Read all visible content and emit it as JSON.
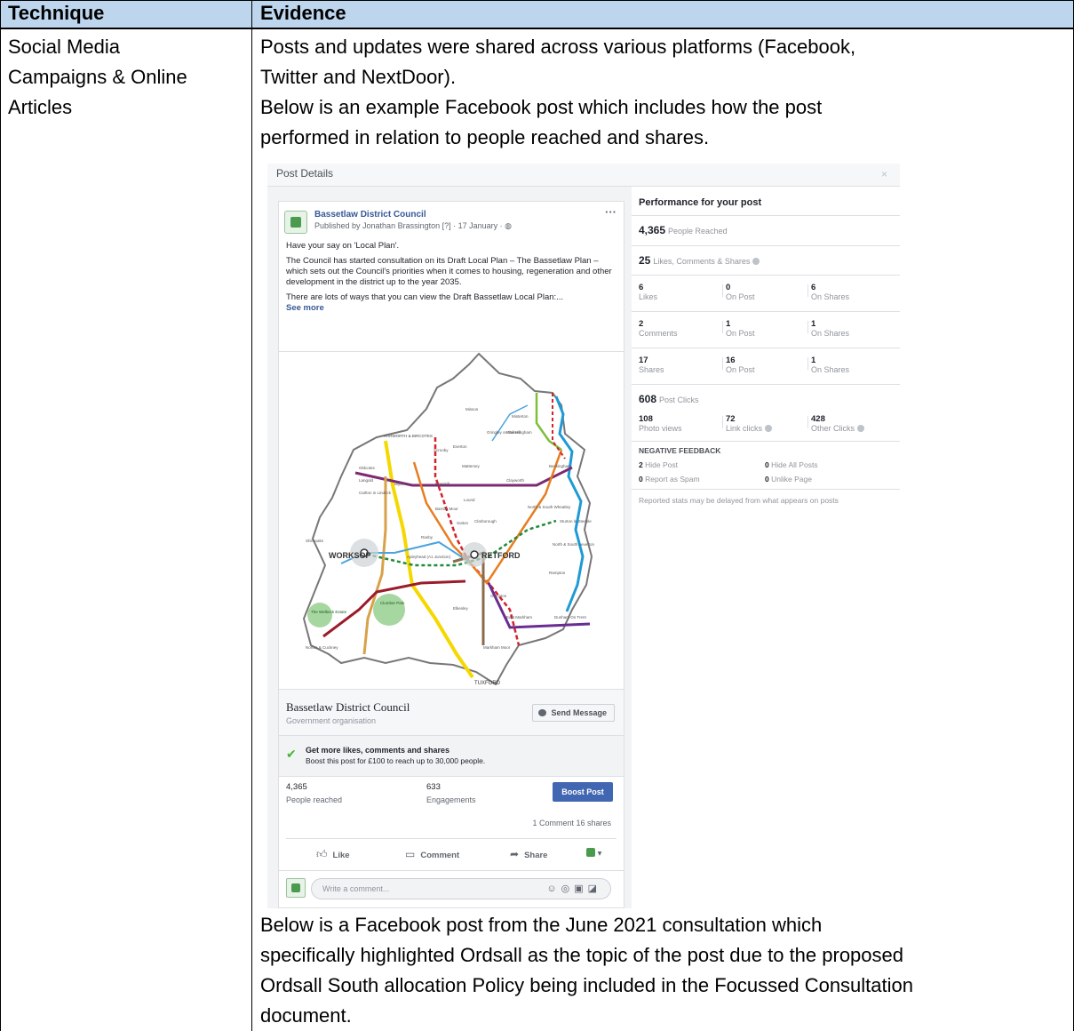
{
  "table": {
    "header_technique": "Technique",
    "header_evidence": "Evidence",
    "technique_lines": [
      "Social Media",
      "Campaigns & Online",
      "Articles"
    ],
    "evidence_top_lines": [
      "Posts and updates were shared across various platforms (Facebook,",
      "Twitter and NextDoor).",
      "Below is an example Facebook post which includes how the post",
      "performed in relation to people reached and shares."
    ],
    "evidence_bottom_lines": [
      "Below is a Facebook post from the June 2021 consultation which",
      "specifically highlighted Ordsall as the topic of the post due to the proposed",
      "Ordsall South allocation Policy being included in the Focussed Consultation",
      "document."
    ]
  },
  "fb": {
    "header_title": "Post Details",
    "close": "×",
    "post": {
      "page_name": "Bassetlaw District Council",
      "published": "Published by Jonathan Brassington [?] · 17 January · ",
      "more": "···",
      "text_1": "Have your say on 'Local Plan'.",
      "text_2": "The Council has started consultation on its Draft Local Plan – The Bassetlaw Plan – which sets out the Council's priorities when it comes to housing, regeneration and other development in the district up to the year 2035.",
      "text_3": "There are lots of ways that you can view the Draft Bassetlaw Local Plan:...",
      "see_more": "See more"
    },
    "map_labels": {
      "worksop": "WORKSOP",
      "retford": "RETFORD",
      "tuxford": "TUXFORD",
      "harworth": "HARWORTH & BIRCOTES",
      "misson": "Misson",
      "misterton": "Misterton",
      "walkeringham": "Walkeringham",
      "beckingham": "Beckingham",
      "clayworth": "Clayworth",
      "everton": "Everton",
      "mattersey": "Mattersey",
      "ranskill": "Ranskill",
      "lound": "Lound",
      "sutton": "Sutton",
      "barnby_moor": "Barnby Moor",
      "clarborough": "Clarborough",
      "north_south_wheatley": "North & South Wheatley",
      "sturton": "Sturton le Steeple",
      "north_south_leverton": "North & South Leverton",
      "rampton": "Rampton",
      "gamston": "Gamston",
      "elkesley": "Elkesley",
      "east_markham": "East Markham",
      "markham_moor": "Markham Moor",
      "dunham": "Dunham On Trent",
      "carlton": "Carlton in Lindrick",
      "langold": "Langold",
      "oldcotes": "Oldcotes",
      "blyth": "Blyth",
      "shireoaks": "Shireoaks",
      "clumber": "Clumber Park",
      "welbeck": "The Welbeck Estate",
      "norton": "Norton & Cuckney",
      "ranby": "Ranby",
      "apleyhead": "Apleyhead (A1 Junction)",
      "gringley": "Gringley on the Hill",
      "scrooby": "Scrooby"
    },
    "footer": {
      "page_name": "Bassetlaw District Council",
      "category": "Government organisation",
      "send_message": "Send Message"
    },
    "boost": {
      "title": "Get more likes, comments and shares",
      "subtitle": "Boost this post for £100 to reach up to 30,000 people."
    },
    "stats": {
      "reached_value": "4,365",
      "reached_label": "People reached",
      "engagements_value": "633",
      "engagements_label": "Engagements",
      "boost_button": "Boost Post"
    },
    "comments_line": "1 Comment  16 shares",
    "actions": {
      "like": "Like",
      "comment": "Comment",
      "share": "Share"
    },
    "comment_placeholder": "Write a comment...",
    "performance": {
      "title": "Performance for your post",
      "people_reached_value": "4,365",
      "people_reached_label": "People Reached",
      "lcs_value": "25",
      "lcs_label": "Likes, Comments & Shares",
      "rows": [
        [
          {
            "v": "6",
            "l": "Likes"
          },
          {
            "v": "0",
            "l": "On Post"
          },
          {
            "v": "6",
            "l": "On Shares"
          }
        ],
        [
          {
            "v": "2",
            "l": "Comments"
          },
          {
            "v": "1",
            "l": "On Post"
          },
          {
            "v": "1",
            "l": "On Shares"
          }
        ],
        [
          {
            "v": "17",
            "l": "Shares"
          },
          {
            "v": "16",
            "l": "On Post"
          },
          {
            "v": "1",
            "l": "On Shares"
          }
        ]
      ],
      "post_clicks_value": "608",
      "post_clicks_label": "Post Clicks",
      "clicks": [
        {
          "v": "108",
          "l": "Photo views"
        },
        {
          "v": "72",
          "l": "Link clicks"
        },
        {
          "v": "428",
          "l": "Other Clicks"
        }
      ],
      "negative_title": "NEGATIVE FEEDBACK",
      "hide_post_value": "2",
      "hide_post_label": "Hide Post",
      "hide_all_value": "0",
      "hide_all_label": "Hide All Posts",
      "spam_value": "0",
      "spam_label": "Report as Spam",
      "unlike_value": "0",
      "unlike_label": "Unlike Page",
      "delay_note": "Reported stats may be delayed from what appears on posts"
    }
  }
}
